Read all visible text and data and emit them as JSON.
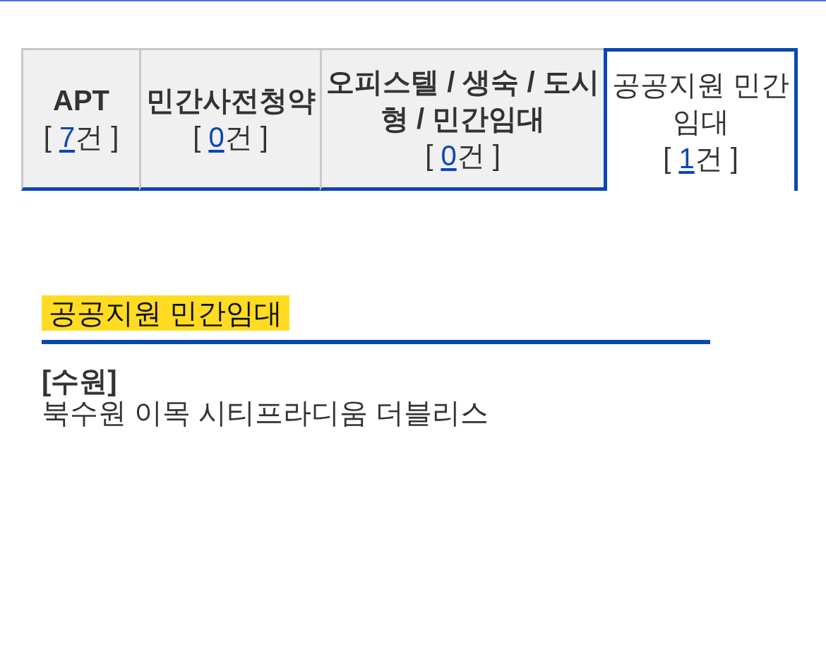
{
  "tabs": [
    {
      "label": "APT",
      "count_before": "[ ",
      "count": "7",
      "count_after": "건 ]",
      "selected": false
    },
    {
      "label": "민간사전청약",
      "count_before": "[ ",
      "count": "0",
      "count_after": "건 ]",
      "selected": false
    },
    {
      "label": "오피스텔 / 생숙 / 도시형 / 민간임대",
      "count_before": "[ ",
      "count": "0",
      "count_after": "건 ]",
      "selected": false
    },
    {
      "label": "공공지원 민간임대",
      "count_before": "[ ",
      "count": "1",
      "count_after": "건 ]",
      "selected": true
    }
  ],
  "section": {
    "title": "공공지원 민간임대",
    "items": [
      {
        "region": "[수원]",
        "name": "북수원 이목 시티프라디움 더블리스"
      }
    ]
  }
}
